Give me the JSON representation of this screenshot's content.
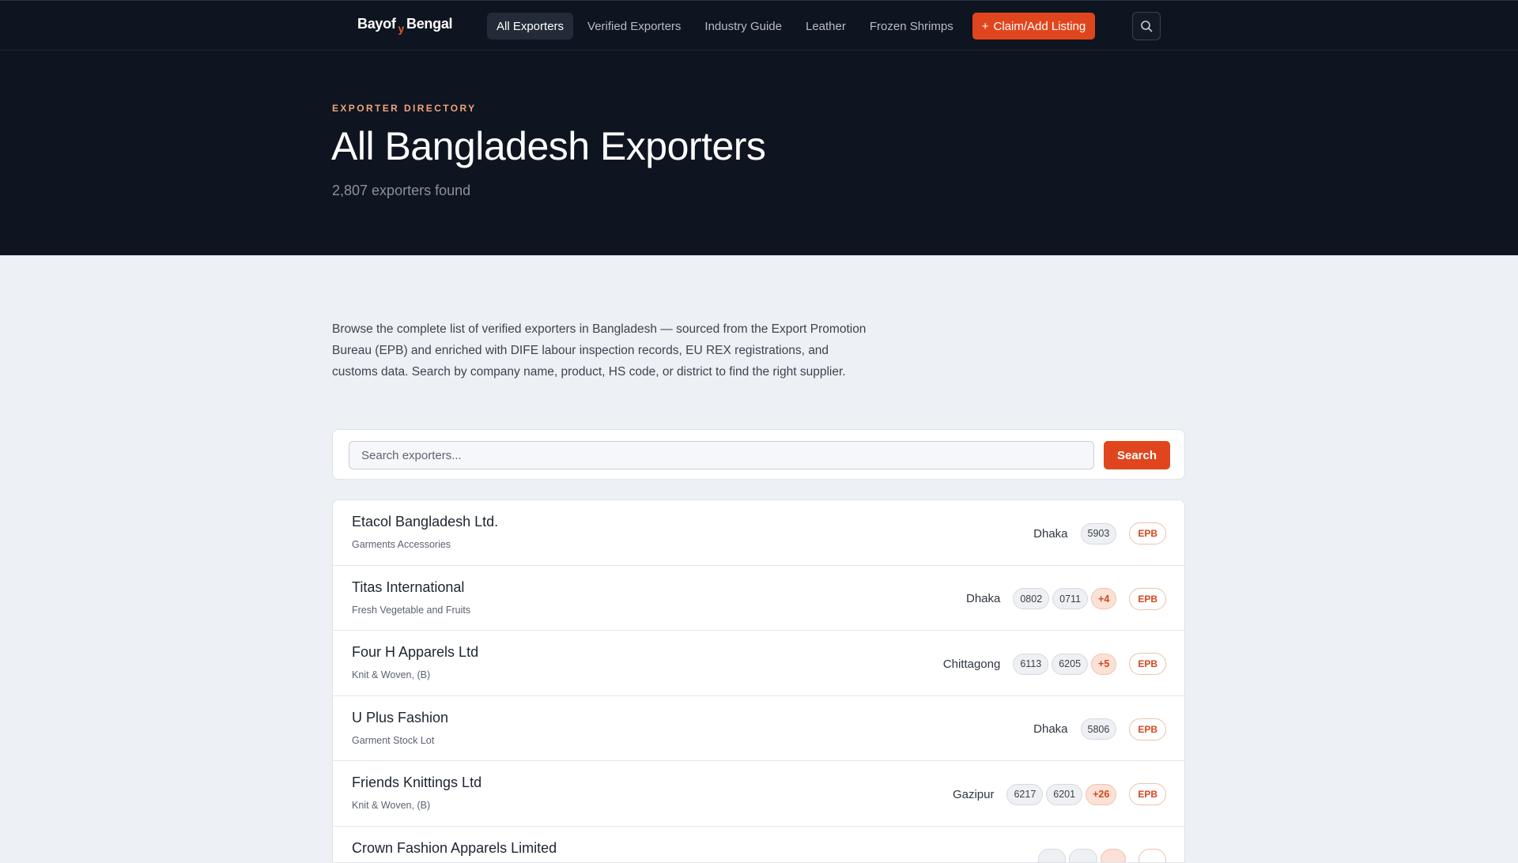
{
  "nav": {
    "logo": {
      "part1": "Bayof",
      "mark": "y",
      "part2": "Bengal"
    },
    "links": [
      "All Exporters",
      "Verified Exporters",
      "Industry Guide",
      "Leather",
      "Frozen Shrimps"
    ],
    "cta_label": "Claim/Add Listing",
    "cta_icon": "+"
  },
  "hero": {
    "eyebrow": "EXPORTER DIRECTORY",
    "title": "All Bangladesh Exporters",
    "count": "2,807 exporters found"
  },
  "intro": "Browse the complete list of verified exporters in Bangladesh — sourced from the Export Promotion Bureau (EPB) and enriched with DIFE labour inspection records, EU REX registrations, and customs data. Search by company name, product, HS code, or district to find the right supplier.",
  "search": {
    "placeholder": "Search exporters...",
    "button": "Search"
  },
  "exporters": [
    {
      "name": "Etacol Bangladesh Ltd.",
      "category": "Garments Accessories",
      "district": "Dhaka",
      "hs_codes": [
        "5903"
      ],
      "more": "",
      "source": "EPB"
    },
    {
      "name": "Titas International",
      "category": "Fresh Vegetable and Fruits",
      "district": "Dhaka",
      "hs_codes": [
        "0802",
        "0711"
      ],
      "more": "+4",
      "source": "EPB"
    },
    {
      "name": "Four H Apparels Ltd",
      "category": "Knit & Woven, (B)",
      "district": "Chittagong",
      "hs_codes": [
        "6113",
        "6205"
      ],
      "more": "+5",
      "source": "EPB"
    },
    {
      "name": "U Plus Fashion",
      "category": "Garment Stock Lot",
      "district": "Dhaka",
      "hs_codes": [
        "5806"
      ],
      "more": "",
      "source": "EPB"
    },
    {
      "name": "Friends Knittings Ltd",
      "category": "Knit & Woven, (B)",
      "district": "Gazipur",
      "hs_codes": [
        "6217",
        "6201"
      ],
      "more": "+26",
      "source": "EPB"
    },
    {
      "name": "Crown Fashion Apparels Limited",
      "category": "",
      "district": "",
      "hs_codes": [],
      "more": "",
      "source": ""
    }
  ],
  "colors": {
    "accent": "#e0461e",
    "nav_bg": "#0f1520",
    "page_bg": "#edf0f4"
  },
  "icons": {
    "search": "search-icon"
  }
}
